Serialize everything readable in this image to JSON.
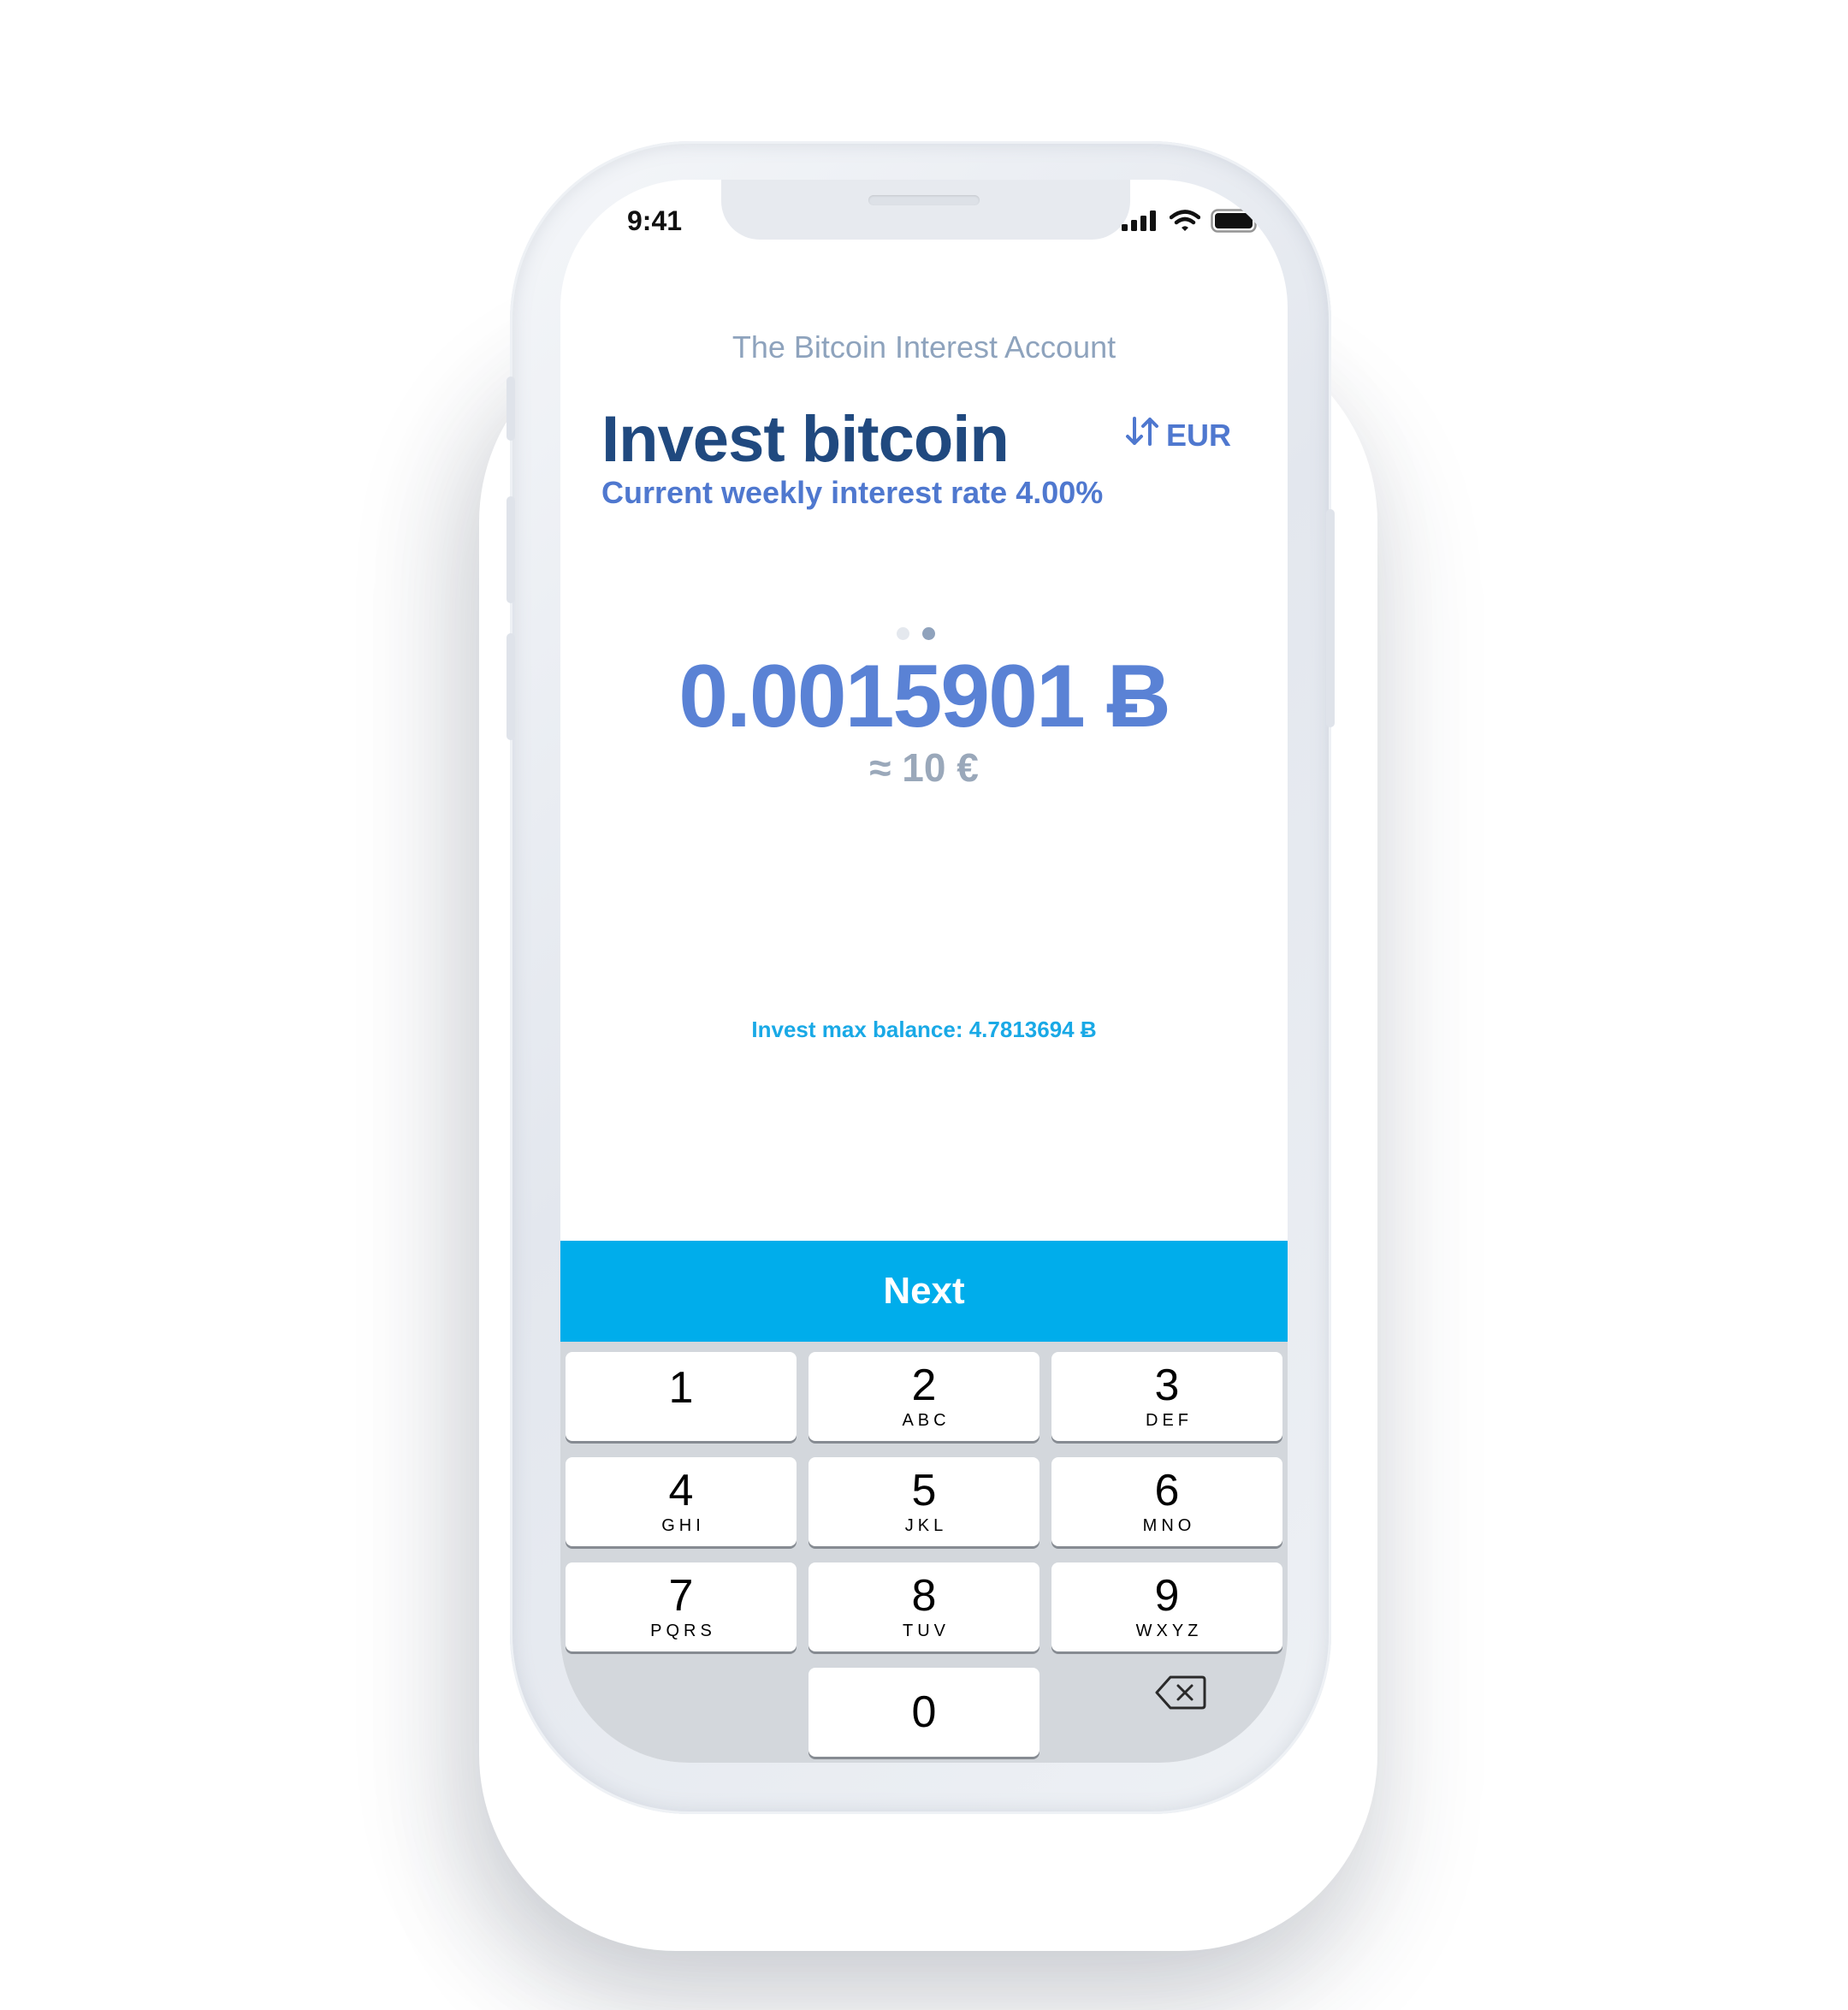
{
  "status_bar": {
    "time": "9:41",
    "icons": [
      "signal-icon",
      "wifi-icon",
      "battery-icon"
    ]
  },
  "header": {
    "account_name": "The Bitcoin Interest Account",
    "title": "Invest bitcoin",
    "rate_text": "Current weekly interest rate 4.00%",
    "currency_toggle": "EUR",
    "toggle_icon": "swap-arrows-icon"
  },
  "pager": {
    "count": 2,
    "active_index": 1
  },
  "amount": {
    "btc": "0.0015901 Ƀ",
    "fiat": "≈ 10 €"
  },
  "max_balance": "Invest max balance: 4.7813694 Ƀ",
  "next_button": "Next",
  "keypad": {
    "keys": [
      {
        "digit": "1",
        "letters": ""
      },
      {
        "digit": "2",
        "letters": "ABC"
      },
      {
        "digit": "3",
        "letters": "DEF"
      },
      {
        "digit": "4",
        "letters": "GHI"
      },
      {
        "digit": "5",
        "letters": "JKL"
      },
      {
        "digit": "6",
        "letters": "MNO"
      },
      {
        "digit": "7",
        "letters": "PQRS"
      },
      {
        "digit": "8",
        "letters": "TUV"
      },
      {
        "digit": "9",
        "letters": "WXYZ"
      },
      {
        "digit": "0",
        "letters": ""
      }
    ],
    "delete_icon": "backspace-icon"
  },
  "colors": {
    "title": "#20497f",
    "accent": "#4f78cf",
    "amount": "#5a82d5",
    "next_button": "#00adeb",
    "max_balance": "#19a9e6",
    "keypad_bg": "#d3d7dc"
  }
}
